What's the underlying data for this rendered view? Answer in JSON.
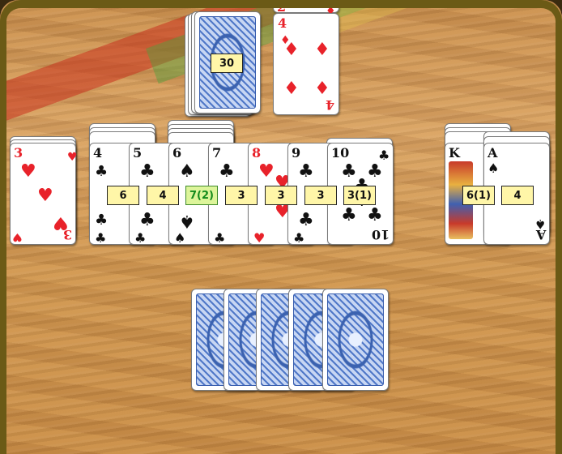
{
  "stock": {
    "count_label": "30"
  },
  "foundation_top": {
    "partial_rank": "2",
    "rank": "4",
    "suit": "♦",
    "color": "red"
  },
  "left_card": {
    "rank": "3",
    "suit": "♥",
    "color": "red"
  },
  "tableau": [
    {
      "rank": "4",
      "suit": "♣",
      "color": "blk",
      "label": "6"
    },
    {
      "rank": "5",
      "suit": "♣",
      "color": "blk",
      "label": "4"
    },
    {
      "rank": "6",
      "suit": "♠",
      "color": "blk",
      "label": "7(2)"
    },
    {
      "rank": "7",
      "suit": "♣",
      "color": "blk",
      "label": "3"
    },
    {
      "rank": "8",
      "suit": "♥",
      "color": "red",
      "label": "3"
    },
    {
      "rank": "9",
      "suit": "♣",
      "color": "blk",
      "label": "3"
    },
    {
      "rank": "10",
      "suit": "♣",
      "color": "blk",
      "label": "3(1)"
    }
  ],
  "right_cards": [
    {
      "rank": "K",
      "suit": "♣",
      "color": "blk",
      "label": "6(1)"
    },
    {
      "rank": "A",
      "suit": "♠",
      "color": "blk",
      "label": "4"
    }
  ],
  "hand": {
    "card_count": 5
  }
}
